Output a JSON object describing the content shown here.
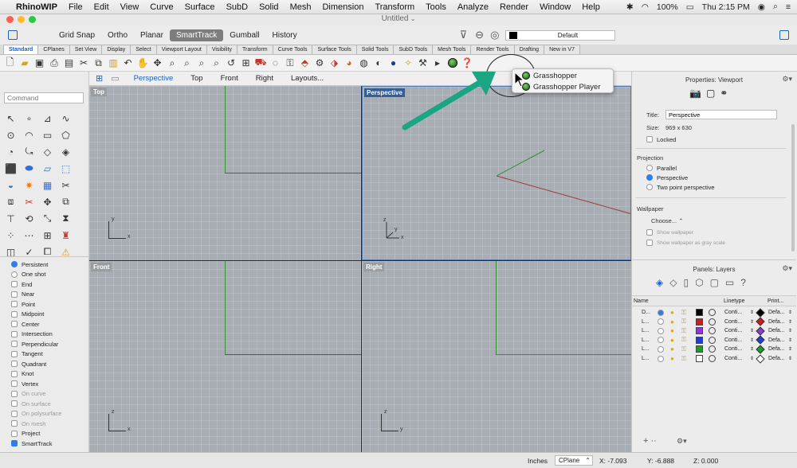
{
  "menubar": {
    "app": "RhinoWIP",
    "items": [
      "File",
      "Edit",
      "View",
      "Curve",
      "Surface",
      "SubD",
      "Solid",
      "Mesh",
      "Dimension",
      "Transform",
      "Tools",
      "Analyze",
      "Render",
      "Window",
      "Help"
    ],
    "battery": "100%",
    "clock": "Thu 2:15 PM"
  },
  "window": {
    "title": "Untitled"
  },
  "toolbar": {
    "buttons": [
      "Grid Snap",
      "Ortho",
      "Planar",
      "SmartTrack",
      "Gumball",
      "History"
    ],
    "layer_value": "Default"
  },
  "tabs": [
    "Standard",
    "CPlanes",
    "Set View",
    "Display",
    "Select",
    "Viewport Layout",
    "Visibility",
    "Transform",
    "Curve Tools",
    "Surface Tools",
    "Solid Tools",
    "SubD Tools",
    "Mesh Tools",
    "Render Tools",
    "Drafting",
    "New in V7"
  ],
  "command": {
    "placeholder": "Command"
  },
  "osnaps": [
    {
      "label": "Persistent",
      "type": "radio",
      "on": true
    },
    {
      "label": "One shot",
      "type": "radio",
      "on": false
    },
    {
      "label": "End",
      "type": "check",
      "dim": false
    },
    {
      "label": "Near",
      "type": "check",
      "dim": false
    },
    {
      "label": "Point",
      "type": "check",
      "dim": false
    },
    {
      "label": "Midpoint",
      "type": "check",
      "dim": false
    },
    {
      "label": "Center",
      "type": "check",
      "dim": false
    },
    {
      "label": "Intersection",
      "type": "check",
      "dim": false
    },
    {
      "label": "Perpendicular",
      "type": "check",
      "dim": false
    },
    {
      "label": "Tangent",
      "type": "check",
      "dim": false
    },
    {
      "label": "Quadrant",
      "type": "check",
      "dim": false
    },
    {
      "label": "Knot",
      "type": "check",
      "dim": false
    },
    {
      "label": "Vertex",
      "type": "check",
      "dim": false
    },
    {
      "label": "On curve",
      "type": "check",
      "dim": true
    },
    {
      "label": "On surface",
      "type": "check",
      "dim": true
    },
    {
      "label": "On polysurface",
      "type": "check",
      "dim": true
    },
    {
      "label": "On mesh",
      "type": "check",
      "dim": true
    },
    {
      "label": "Project",
      "type": "check",
      "dim": false
    },
    {
      "label": "SmartTrack",
      "type": "check",
      "dim": false
    }
  ],
  "viewport_tabs": [
    "Perspective",
    "Top",
    "Front",
    "Right",
    "Layouts..."
  ],
  "viewports": {
    "top": "Top",
    "perspective": "Perspective",
    "front": "Front",
    "right": "Right"
  },
  "axis_labels": {
    "x": "x",
    "y": "y",
    "z": "z"
  },
  "popup": {
    "items": [
      "Grasshopper",
      "Grasshopper Player"
    ]
  },
  "properties": {
    "header": "Properties: Viewport",
    "title_label": "Title:",
    "title_value": "Perspective",
    "size_label": "Size:",
    "size_value": "969 x 630",
    "locked": "Locked",
    "projection_label": "Projection",
    "projection_options": [
      "Parallel",
      "Perspective",
      "Two point perspective"
    ],
    "wallpaper_label": "Wallpaper",
    "choose": "Choose...",
    "show_wallpaper": "Show wallpaper",
    "show_gray": "Show wallpaper as gray scale"
  },
  "layers": {
    "header": "Panels: Layers",
    "col_name": "Name",
    "col_linetype": "Linetype",
    "col_print": "Print...",
    "rows": [
      {
        "name": "D...",
        "color": "#000000",
        "linetype": "Conti...",
        "print": "Defa..."
      },
      {
        "name": "L...",
        "color": "#d11c1c",
        "linetype": "Conti...",
        "print": "Defa..."
      },
      {
        "name": "L...",
        "color": "#8a3bd1",
        "linetype": "Conti...",
        "print": "Defa..."
      },
      {
        "name": "L...",
        "color": "#1f3fd1",
        "linetype": "Conti...",
        "print": "Defa..."
      },
      {
        "name": "L...",
        "color": "#1c9a2a",
        "linetype": "Conti...",
        "print": "Defa..."
      },
      {
        "name": "L...",
        "color": "#ffffff",
        "linetype": "Conti...",
        "print": "Defa..."
      }
    ]
  },
  "status": {
    "units": "Inches",
    "cplane": "CPlane",
    "x": "X: -7.093",
    "y": "Y: -6.888",
    "z": "Z: 0.000"
  },
  "colors": {
    "accent": "#1762c4",
    "annotation_arrow": "#1aa583"
  }
}
